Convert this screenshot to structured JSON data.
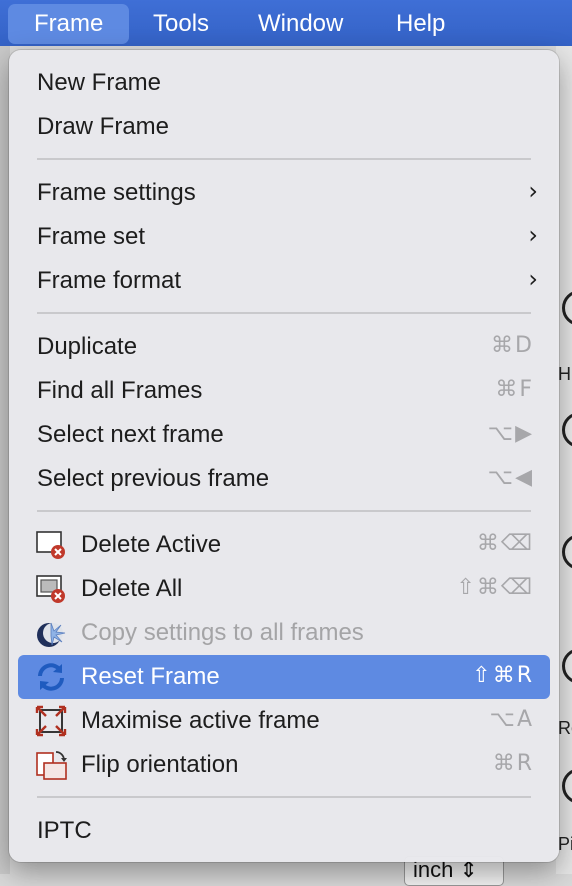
{
  "menubar": {
    "items": [
      {
        "label": "Frame"
      },
      {
        "label": "Tools"
      },
      {
        "label": "Window"
      },
      {
        "label": "Help"
      }
    ]
  },
  "background": {
    "letters": [
      "H",
      "Ro",
      "Pi"
    ],
    "units_select": "inch ⇕"
  },
  "menu": {
    "new_frame": "New Frame",
    "draw_frame": "Draw Frame",
    "frame_settings": "Frame settings",
    "frame_set": "Frame set",
    "frame_format": "Frame format",
    "duplicate": {
      "label": "Duplicate",
      "shortcut": "⌘D"
    },
    "find_all": {
      "label": "Find all Frames",
      "shortcut": "⌘F"
    },
    "select_next": {
      "label": "Select next frame",
      "shortcut": "⌥▶"
    },
    "select_prev": {
      "label": "Select previous frame",
      "shortcut": "⌥◀"
    },
    "delete_active": {
      "label": "Delete Active",
      "shortcut": "⌘⌫",
      "icon": "delete-active-icon"
    },
    "delete_all": {
      "label": "Delete All",
      "shortcut": "⇧⌘⌫",
      "icon": "delete-all-icon"
    },
    "copy_settings": {
      "label": "Copy settings to all frames",
      "icon": "copy-settings-icon",
      "disabled": true
    },
    "reset_frame": {
      "label": "Reset Frame",
      "shortcut": "⇧⌘R",
      "icon": "reset-icon",
      "highlighted": true
    },
    "maximise": {
      "label": "Maximise active frame",
      "shortcut": "⌥A",
      "icon": "maximise-icon"
    },
    "flip": {
      "label": "Flip orientation",
      "shortcut": "⌘R",
      "icon": "flip-orientation-icon"
    },
    "iptc": "IPTC"
  },
  "colors": {
    "menubar": "#3462c6",
    "highlight": "#5e8ae2",
    "delete_badge": "#c0392b"
  }
}
